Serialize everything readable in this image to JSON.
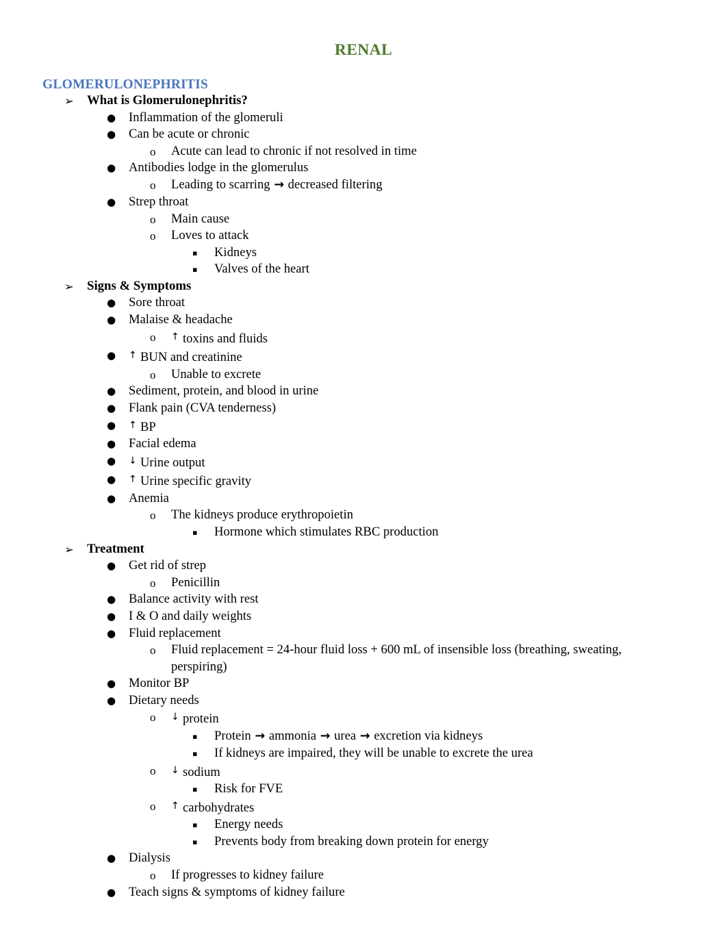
{
  "document": {
    "title": "RENAL",
    "title_color": "#4e7a32",
    "section_color": "#4a76bd"
  },
  "section": {
    "heading": "GLOMERULONEPHRITIS"
  },
  "glyphs": {
    "level1": "➢",
    "level2": "●",
    "level3": "o",
    "level4": "▪",
    "up_arrow": "↑",
    "down_arrow": "↓",
    "right_arrow": "→"
  },
  "outline": [
    {
      "id": "l1-what-is",
      "level": 1,
      "text": "What is Glomerulonephritis?"
    },
    {
      "id": "l2-inflammation",
      "level": 2,
      "text": "Inflammation of the glomeruli"
    },
    {
      "id": "l2-acute-chronic",
      "level": 2,
      "text": "Can be acute or chronic"
    },
    {
      "id": "l3-acute-lead",
      "level": 3,
      "text": "Acute can lead to chronic if not resolved in time"
    },
    {
      "id": "l2-antibodies",
      "level": 2,
      "text": "Antibodies lodge in the glomerulus"
    },
    {
      "id": "l3-scarring",
      "level": 3,
      "text": "Leading to scarring → decreased filtering"
    },
    {
      "id": "l2-strep-throat",
      "level": 2,
      "text": "Strep throat"
    },
    {
      "id": "l3-main-cause",
      "level": 3,
      "text": "Main cause"
    },
    {
      "id": "l3-loves-attack",
      "level": 3,
      "text": "Loves to attack"
    },
    {
      "id": "l4-kidneys",
      "level": 4,
      "text": "Kidneys"
    },
    {
      "id": "l4-valves",
      "level": 4,
      "text": "Valves of the heart"
    },
    {
      "id": "l1-signs-symptoms",
      "level": 1,
      "text": "Signs & Symptoms"
    },
    {
      "id": "l2-sore-throat",
      "level": 2,
      "text": "Sore throat"
    },
    {
      "id": "l2-malaise",
      "level": 2,
      "text": "Malaise & headache"
    },
    {
      "id": "l3-toxins-fluids",
      "level": 3,
      "text": "↑ toxins and fluids"
    },
    {
      "id": "l2-bun-creatinine",
      "level": 2,
      "text": "↑ BUN and creatinine"
    },
    {
      "id": "l3-unable-excrete",
      "level": 3,
      "text": "Unable to excrete"
    },
    {
      "id": "l2-sediment",
      "level": 2,
      "text": "Sediment, protein, and blood in urine"
    },
    {
      "id": "l2-flank-pain",
      "level": 2,
      "text": "Flank pain (CVA tenderness)"
    },
    {
      "id": "l2-bp-up",
      "level": 2,
      "text": "↑ BP"
    },
    {
      "id": "l2-facial-edema",
      "level": 2,
      "text": "Facial edema"
    },
    {
      "id": "l2-urine-output",
      "level": 2,
      "text": "↓ Urine output"
    },
    {
      "id": "l2-urine-gravity",
      "level": 2,
      "text": "↑ Urine specific gravity"
    },
    {
      "id": "l2-anemia",
      "level": 2,
      "text": "Anemia"
    },
    {
      "id": "l3-erythropoietin",
      "level": 3,
      "text": "The kidneys produce erythropoietin"
    },
    {
      "id": "l4-hormone-rbc",
      "level": 4,
      "text": "Hormone which stimulates RBC production"
    },
    {
      "id": "l1-treatment",
      "level": 1,
      "text": "Treatment"
    },
    {
      "id": "l2-get-rid-strep",
      "level": 2,
      "text": "Get rid of strep"
    },
    {
      "id": "l3-penicillin",
      "level": 3,
      "text": "Penicillin"
    },
    {
      "id": "l2-balance-activity",
      "level": 2,
      "text": "Balance activity with rest"
    },
    {
      "id": "l2-io-weights",
      "level": 2,
      "text": "I & O and daily weights"
    },
    {
      "id": "l2-fluid-replacement",
      "level": 2,
      "text": "Fluid replacement"
    },
    {
      "id": "l3-fluid-formula",
      "level": 3,
      "text": "Fluid replacement = 24-hour fluid loss + 600 mL of insensible loss (breathing, sweating, perspiring)"
    },
    {
      "id": "l2-monitor-bp",
      "level": 2,
      "text": "Monitor BP"
    },
    {
      "id": "l2-dietary-needs",
      "level": 2,
      "text": "Dietary needs"
    },
    {
      "id": "l3-protein-down",
      "level": 3,
      "text": "↓ protein"
    },
    {
      "id": "l4-protein-chain",
      "level": 4,
      "text": "Protein → ammonia → urea → excretion via kidneys"
    },
    {
      "id": "l4-impaired-urea",
      "level": 4,
      "text": "If kidneys are impaired, they will be unable to excrete the urea"
    },
    {
      "id": "l3-sodium-down",
      "level": 3,
      "text": "↓ sodium"
    },
    {
      "id": "l4-risk-fve",
      "level": 4,
      "text": "Risk for FVE"
    },
    {
      "id": "l3-carbs-up",
      "level": 3,
      "text": "↑ carbohydrates"
    },
    {
      "id": "l4-energy-needs",
      "level": 4,
      "text": "Energy needs"
    },
    {
      "id": "l4-prevents-breakdown",
      "level": 4,
      "text": "Prevents body from breaking down protein for energy"
    },
    {
      "id": "l2-dialysis",
      "level": 2,
      "text": "Dialysis"
    },
    {
      "id": "l3-progresses-failure",
      "level": 3,
      "text": "If progresses to kidney failure"
    },
    {
      "id": "l2-teach-signs",
      "level": 2,
      "text": "Teach signs & symptoms of kidney failure"
    }
  ]
}
